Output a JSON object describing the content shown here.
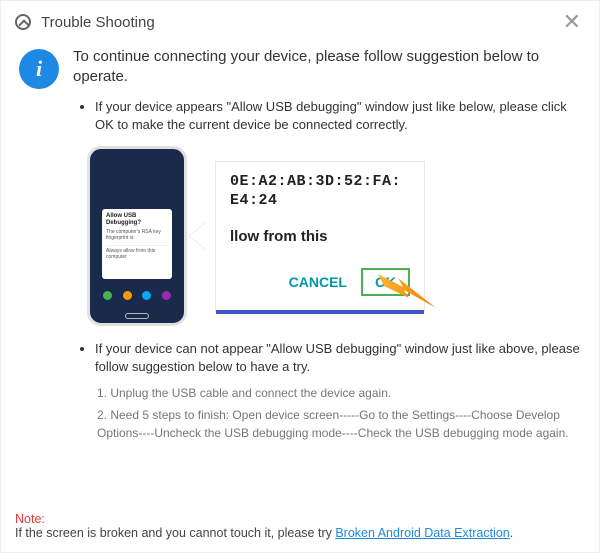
{
  "title": "Trouble Shooting",
  "headline": "To continue connecting your device, please follow suggestion below to operate.",
  "bullet1": "If your device appears \"Allow USB debugging\" window just like below, please click OK to make the current device  be connected correctly.",
  "bullet2": "If your device can not appear \"Allow USB debugging\" window just like above, please follow suggestion below to have a try.",
  "steps": {
    "s1": "1. Unplug the USB cable and connect the device again.",
    "s2": "2. Need 5 steps to finish: Open device screen-----Go to the Settings----Choose Develop Options----Uncheck the USB debugging mode----Check the USB debugging mode again."
  },
  "phone_dialog": {
    "title": "Allow USB Debugging?",
    "body": "The computer's RSA key fingerprint is:",
    "always": "Always allow from this computer"
  },
  "zoom": {
    "mac1": "0E:A2:AB:3D:52:FA:",
    "mac2": "E4:24",
    "line": "llow from this",
    "cancel": "CANCEL",
    "ok": "OK"
  },
  "note": {
    "label": "Note:",
    "text": "If the screen is broken and you cannot touch it, please try ",
    "link": "Broken Android Data Extraction",
    "suffix": "."
  }
}
